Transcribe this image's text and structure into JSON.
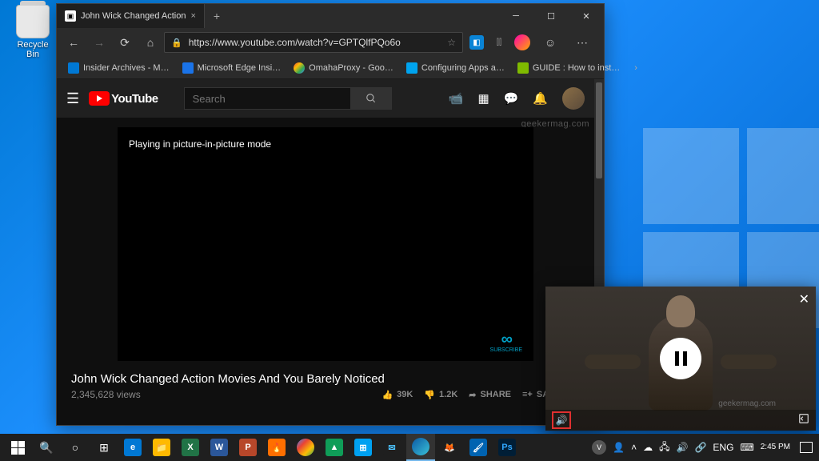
{
  "desktop": {
    "recycle_bin": "Recycle Bin"
  },
  "browser": {
    "tab_title": "John Wick Changed Action",
    "url": "https://www.youtube.com/watch?v=GPTQlfPQo6o",
    "favorites": [
      "Insider Archives - M…",
      "Microsoft Edge Insi…",
      "OmahaProxy - Goo…",
      "Configuring Apps a…",
      "GUIDE : How to inst…"
    ]
  },
  "youtube": {
    "logo": "YouTube",
    "search_placeholder": "Search",
    "pip_message": "Playing in picture-in-picture mode",
    "subscribe_badge": "SUBSCRIBE",
    "video_title": "John Wick Changed Action Movies And You Barely Noticed",
    "views": "2,345,628 views",
    "likes": "39K",
    "dislikes": "1.2K",
    "share": "SHARE",
    "save": "SAVE",
    "watermark": "geekermag.com"
  },
  "pip": {
    "watermark": "geekermag.com"
  },
  "taskbar": {
    "lang": "ENG",
    "time": "2:45 PM",
    "date": "2:45 PM"
  }
}
